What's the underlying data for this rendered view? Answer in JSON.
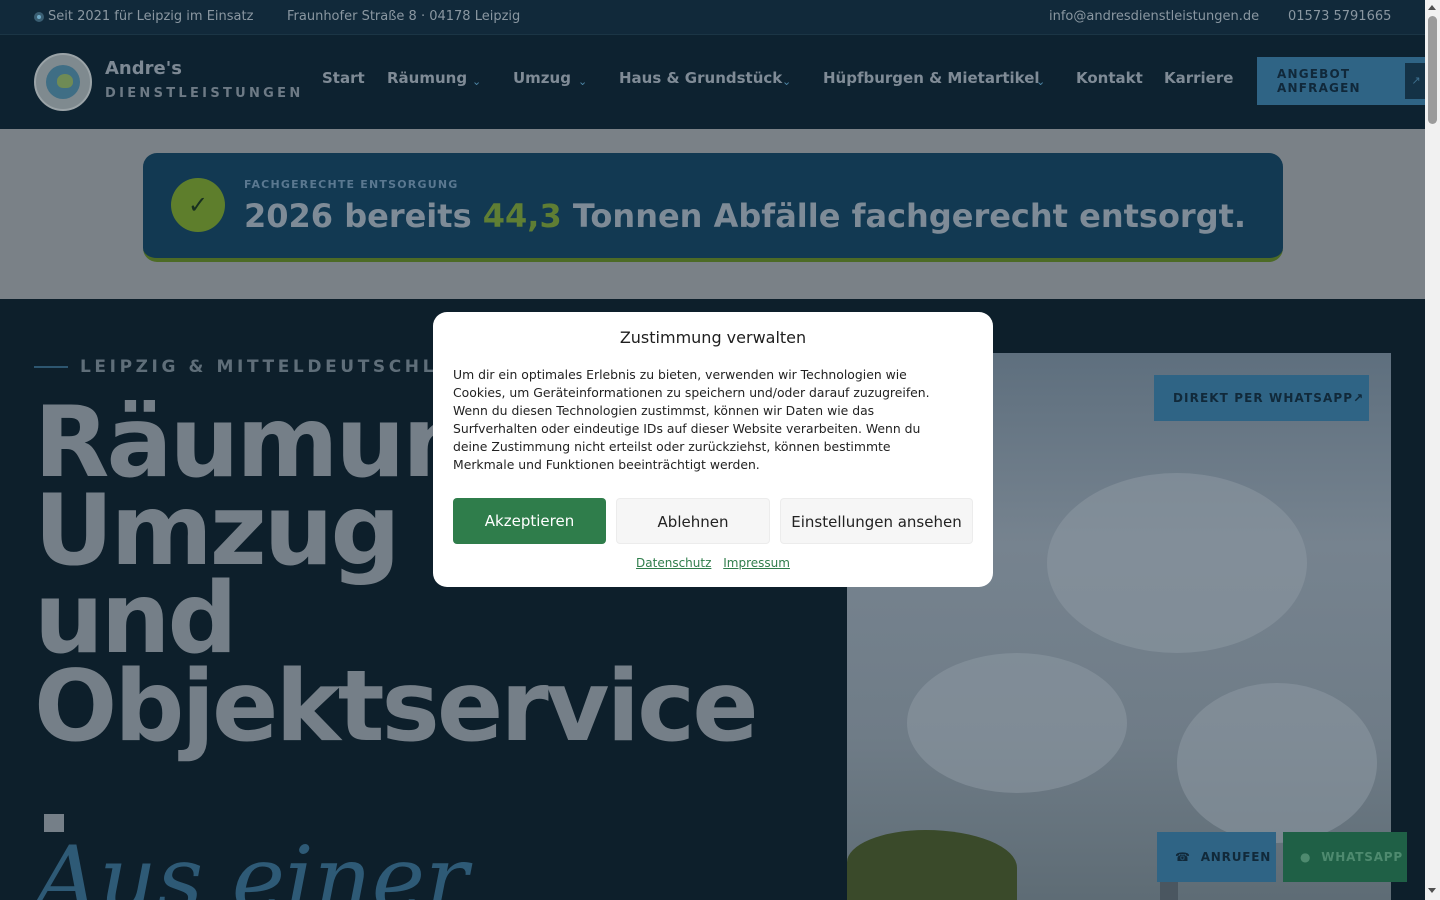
{
  "topbar": {
    "since": "Seit 2021 für Leipzig im Einsatz",
    "address": "Fraunhofer Straße 8 · 04178 Leipzig",
    "email": "info@andresdienstleistungen.de",
    "phone": "01573 5791665"
  },
  "header": {
    "brand_name": "Andre's",
    "brand_sub": "DIENSTLEISTUNGEN",
    "nav": [
      {
        "label": "Start"
      },
      {
        "label": "Räumung",
        "has_dropdown": true
      },
      {
        "label": "Umzug",
        "has_dropdown": true
      },
      {
        "label": "Haus & Grundstück",
        "has_dropdown": true
      },
      {
        "label": "Hüpfburgen & Mietartikel",
        "has_dropdown": true
      },
      {
        "label": "Kontakt"
      },
      {
        "label": "Karriere"
      }
    ],
    "cta_line1": "ANGEBOT",
    "cta_line2": "ANFRAGEN",
    "cta_arrow": "↗"
  },
  "banner": {
    "kicker": "FACHGERECHTE ENTSORGUNG",
    "title_prefix": "2026 bereits",
    "tonnage": "44,3",
    "title_suffix": "Tonnen Abfälle fachgerecht entsorgt.",
    "check_glyph": "✓"
  },
  "hero": {
    "kicker": "LEIPZIG & MITTELDEUTSCHLAND",
    "title_lines": [
      "Räumung,",
      "Umzug",
      "und",
      "Objektservice"
    ],
    "title_end": ".",
    "subtitle": "Aus einer",
    "whatsapp_direct": "DIREKT PER WHATSAPP↗"
  },
  "floating": {
    "call_icon": "☎",
    "call": "ANRUFEN",
    "whatsapp_icon": "●",
    "whatsapp": "WHATSAPP"
  },
  "consent": {
    "title": "Zustimmung verwalten",
    "text": "Um dir ein optimales Erlebnis zu bieten, verwenden wir Technologien wie Cookies, um Geräteinformationen zu speichern und/oder darauf zuzugreifen. Wenn du diesen Technologien zustimmst, können wir Daten wie das Surfverhalten oder eindeutige IDs auf dieser Website verarbeiten. Wenn du deine Zustimmung nicht erteilst oder zurückziehst, können bestimmte Merkmale und Funktionen beeinträchtigt werden.",
    "accept": "Akzeptieren",
    "deny": "Ablehnen",
    "preferences": "Einstellungen ansehen",
    "privacy_link": "Datenschutz",
    "imprint_link": "Impressum"
  },
  "colors": {
    "accent_blue": "#2f6485",
    "accent_green": "#2f7d4b",
    "tonnage_green": "#5f7e34"
  }
}
